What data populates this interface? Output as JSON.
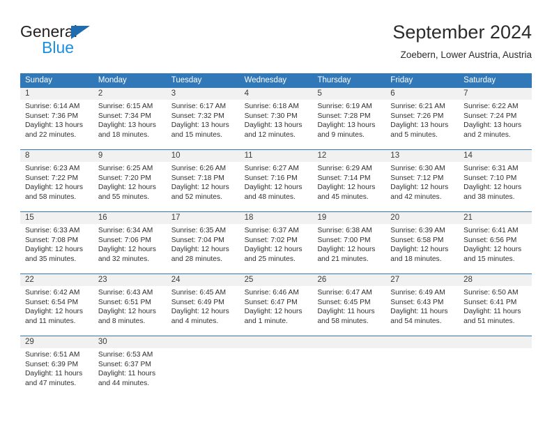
{
  "brand": {
    "name_part1": "General",
    "name_part2": "Blue",
    "triangle_icon": "triangle-icon",
    "colors": {
      "dark": "#231f20",
      "blue": "#1a8fe0",
      "triangle": "#1f6cb0"
    }
  },
  "header": {
    "title": "September 2024",
    "subtitle": "Zoebern, Lower Austria, Austria"
  },
  "theme": {
    "header_row_bg": "#3178b8",
    "daynum_bg": "#f1f1f1",
    "row_divider": "#3178b8",
    "text": "#2f2f2f"
  },
  "weekdays": [
    "Sunday",
    "Monday",
    "Tuesday",
    "Wednesday",
    "Thursday",
    "Friday",
    "Saturday"
  ],
  "weeks": [
    {
      "days": [
        {
          "num": "1",
          "sunrise": "Sunrise: 6:14 AM",
          "sunset": "Sunset: 7:36 PM",
          "daylight1": "Daylight: 13 hours",
          "daylight2": "and 22 minutes."
        },
        {
          "num": "2",
          "sunrise": "Sunrise: 6:15 AM",
          "sunset": "Sunset: 7:34 PM",
          "daylight1": "Daylight: 13 hours",
          "daylight2": "and 18 minutes."
        },
        {
          "num": "3",
          "sunrise": "Sunrise: 6:17 AM",
          "sunset": "Sunset: 7:32 PM",
          "daylight1": "Daylight: 13 hours",
          "daylight2": "and 15 minutes."
        },
        {
          "num": "4",
          "sunrise": "Sunrise: 6:18 AM",
          "sunset": "Sunset: 7:30 PM",
          "daylight1": "Daylight: 13 hours",
          "daylight2": "and 12 minutes."
        },
        {
          "num": "5",
          "sunrise": "Sunrise: 6:19 AM",
          "sunset": "Sunset: 7:28 PM",
          "daylight1": "Daylight: 13 hours",
          "daylight2": "and 9 minutes."
        },
        {
          "num": "6",
          "sunrise": "Sunrise: 6:21 AM",
          "sunset": "Sunset: 7:26 PM",
          "daylight1": "Daylight: 13 hours",
          "daylight2": "and 5 minutes."
        },
        {
          "num": "7",
          "sunrise": "Sunrise: 6:22 AM",
          "sunset": "Sunset: 7:24 PM",
          "daylight1": "Daylight: 13 hours",
          "daylight2": "and 2 minutes."
        }
      ]
    },
    {
      "days": [
        {
          "num": "8",
          "sunrise": "Sunrise: 6:23 AM",
          "sunset": "Sunset: 7:22 PM",
          "daylight1": "Daylight: 12 hours",
          "daylight2": "and 58 minutes."
        },
        {
          "num": "9",
          "sunrise": "Sunrise: 6:25 AM",
          "sunset": "Sunset: 7:20 PM",
          "daylight1": "Daylight: 12 hours",
          "daylight2": "and 55 minutes."
        },
        {
          "num": "10",
          "sunrise": "Sunrise: 6:26 AM",
          "sunset": "Sunset: 7:18 PM",
          "daylight1": "Daylight: 12 hours",
          "daylight2": "and 52 minutes."
        },
        {
          "num": "11",
          "sunrise": "Sunrise: 6:27 AM",
          "sunset": "Sunset: 7:16 PM",
          "daylight1": "Daylight: 12 hours",
          "daylight2": "and 48 minutes."
        },
        {
          "num": "12",
          "sunrise": "Sunrise: 6:29 AM",
          "sunset": "Sunset: 7:14 PM",
          "daylight1": "Daylight: 12 hours",
          "daylight2": "and 45 minutes."
        },
        {
          "num": "13",
          "sunrise": "Sunrise: 6:30 AM",
          "sunset": "Sunset: 7:12 PM",
          "daylight1": "Daylight: 12 hours",
          "daylight2": "and 42 minutes."
        },
        {
          "num": "14",
          "sunrise": "Sunrise: 6:31 AM",
          "sunset": "Sunset: 7:10 PM",
          "daylight1": "Daylight: 12 hours",
          "daylight2": "and 38 minutes."
        }
      ]
    },
    {
      "days": [
        {
          "num": "15",
          "sunrise": "Sunrise: 6:33 AM",
          "sunset": "Sunset: 7:08 PM",
          "daylight1": "Daylight: 12 hours",
          "daylight2": "and 35 minutes."
        },
        {
          "num": "16",
          "sunrise": "Sunrise: 6:34 AM",
          "sunset": "Sunset: 7:06 PM",
          "daylight1": "Daylight: 12 hours",
          "daylight2": "and 32 minutes."
        },
        {
          "num": "17",
          "sunrise": "Sunrise: 6:35 AM",
          "sunset": "Sunset: 7:04 PM",
          "daylight1": "Daylight: 12 hours",
          "daylight2": "and 28 minutes."
        },
        {
          "num": "18",
          "sunrise": "Sunrise: 6:37 AM",
          "sunset": "Sunset: 7:02 PM",
          "daylight1": "Daylight: 12 hours",
          "daylight2": "and 25 minutes."
        },
        {
          "num": "19",
          "sunrise": "Sunrise: 6:38 AM",
          "sunset": "Sunset: 7:00 PM",
          "daylight1": "Daylight: 12 hours",
          "daylight2": "and 21 minutes."
        },
        {
          "num": "20",
          "sunrise": "Sunrise: 6:39 AM",
          "sunset": "Sunset: 6:58 PM",
          "daylight1": "Daylight: 12 hours",
          "daylight2": "and 18 minutes."
        },
        {
          "num": "21",
          "sunrise": "Sunrise: 6:41 AM",
          "sunset": "Sunset: 6:56 PM",
          "daylight1": "Daylight: 12 hours",
          "daylight2": "and 15 minutes."
        }
      ]
    },
    {
      "days": [
        {
          "num": "22",
          "sunrise": "Sunrise: 6:42 AM",
          "sunset": "Sunset: 6:54 PM",
          "daylight1": "Daylight: 12 hours",
          "daylight2": "and 11 minutes."
        },
        {
          "num": "23",
          "sunrise": "Sunrise: 6:43 AM",
          "sunset": "Sunset: 6:51 PM",
          "daylight1": "Daylight: 12 hours",
          "daylight2": "and 8 minutes."
        },
        {
          "num": "24",
          "sunrise": "Sunrise: 6:45 AM",
          "sunset": "Sunset: 6:49 PM",
          "daylight1": "Daylight: 12 hours",
          "daylight2": "and 4 minutes."
        },
        {
          "num": "25",
          "sunrise": "Sunrise: 6:46 AM",
          "sunset": "Sunset: 6:47 PM",
          "daylight1": "Daylight: 12 hours",
          "daylight2": "and 1 minute."
        },
        {
          "num": "26",
          "sunrise": "Sunrise: 6:47 AM",
          "sunset": "Sunset: 6:45 PM",
          "daylight1": "Daylight: 11 hours",
          "daylight2": "and 58 minutes."
        },
        {
          "num": "27",
          "sunrise": "Sunrise: 6:49 AM",
          "sunset": "Sunset: 6:43 PM",
          "daylight1": "Daylight: 11 hours",
          "daylight2": "and 54 minutes."
        },
        {
          "num": "28",
          "sunrise": "Sunrise: 6:50 AM",
          "sunset": "Sunset: 6:41 PM",
          "daylight1": "Daylight: 11 hours",
          "daylight2": "and 51 minutes."
        }
      ]
    },
    {
      "days": [
        {
          "num": "29",
          "sunrise": "Sunrise: 6:51 AM",
          "sunset": "Sunset: 6:39 PM",
          "daylight1": "Daylight: 11 hours",
          "daylight2": "and 47 minutes."
        },
        {
          "num": "30",
          "sunrise": "Sunrise: 6:53 AM",
          "sunset": "Sunset: 6:37 PM",
          "daylight1": "Daylight: 11 hours",
          "daylight2": "and 44 minutes."
        },
        {
          "num": "",
          "sunrise": "",
          "sunset": "",
          "daylight1": "",
          "daylight2": ""
        },
        {
          "num": "",
          "sunrise": "",
          "sunset": "",
          "daylight1": "",
          "daylight2": ""
        },
        {
          "num": "",
          "sunrise": "",
          "sunset": "",
          "daylight1": "",
          "daylight2": ""
        },
        {
          "num": "",
          "sunrise": "",
          "sunset": "",
          "daylight1": "",
          "daylight2": ""
        },
        {
          "num": "",
          "sunrise": "",
          "sunset": "",
          "daylight1": "",
          "daylight2": ""
        }
      ]
    }
  ]
}
